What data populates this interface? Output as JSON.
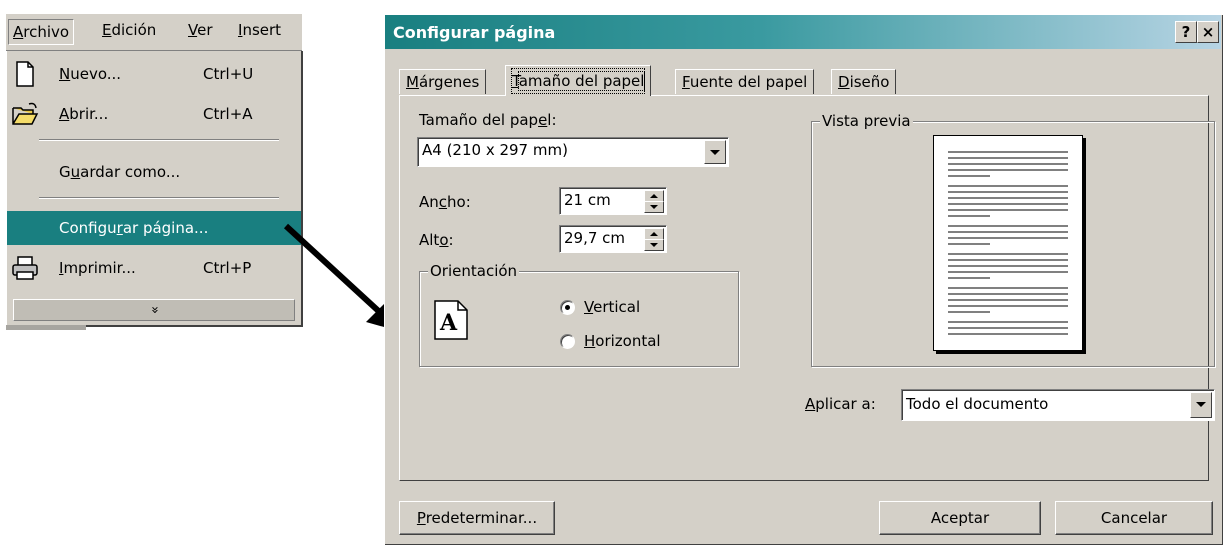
{
  "menubar": {
    "items": [
      {
        "label": "Archivo",
        "u": "A"
      },
      {
        "label": "Edición",
        "u": "E"
      },
      {
        "label": "Ver",
        "u": "V"
      },
      {
        "label": "Insert",
        "u": "I"
      }
    ]
  },
  "file_menu": {
    "items": [
      {
        "label_pre": "",
        "label_u": "N",
        "label_post": "uevo...",
        "shortcut": "Ctrl+U",
        "icon": "new-document-icon"
      },
      {
        "label_pre": "",
        "label_u": "A",
        "label_post": "brir...",
        "shortcut": "Ctrl+A",
        "icon": "open-folder-icon"
      },
      {
        "label_pre": "G",
        "label_u": "u",
        "label_post": "ardar como...",
        "shortcut": "",
        "icon": ""
      },
      {
        "label_pre": "Configu",
        "label_u": "r",
        "label_post": "ar página...",
        "shortcut": "",
        "icon": ""
      },
      {
        "label_pre": "",
        "label_u": "I",
        "label_post": "mprimir...",
        "shortcut": "Ctrl+P",
        "icon": "printer-icon"
      }
    ],
    "more_glyph": "»",
    "highlight_color": "#197f80"
  },
  "dialog": {
    "title": "Configurar página",
    "help_btn": "?",
    "close_btn": "×",
    "tabs": [
      {
        "label_pre": "",
        "label_u": "M",
        "label_post": "árgenes"
      },
      {
        "label_pre": "",
        "label_u": "T",
        "label_post": "amaño del papel"
      },
      {
        "label_pre": "",
        "label_u": "F",
        "label_post": "uente del papel"
      },
      {
        "label_pre": "",
        "label_u": "D",
        "label_post": "iseño"
      }
    ],
    "paper_size": {
      "label_pre": "Tamaño del pap",
      "label_u": "e",
      "label_post": "l:",
      "value": "A4 (210 x 297 mm)"
    },
    "width": {
      "label_pre": "An",
      "label_u": "c",
      "label_post": "ho:",
      "value": "21 cm"
    },
    "height": {
      "label_pre": "Alt",
      "label_u": "o",
      "label_post": ":",
      "value": "29,7 cm"
    },
    "orientation": {
      "legend": "Orientación",
      "icon_letter": "A",
      "vertical": {
        "label_u": "V",
        "label_post": "ertical",
        "selected": true
      },
      "horizontal": {
        "label_u": "H",
        "label_post": "orizontal",
        "selected": false
      }
    },
    "preview": {
      "legend": "Vista previa"
    },
    "apply": {
      "label_pre": "",
      "label_u": "A",
      "label_post": "plicar a:",
      "value": "Todo el documento"
    },
    "buttons": {
      "default": {
        "label_pre": "",
        "label_u": "P",
        "label_post": "redeterminar..."
      },
      "ok": "Aceptar",
      "cancel": "Cancelar"
    },
    "title_color": "#197f80"
  }
}
